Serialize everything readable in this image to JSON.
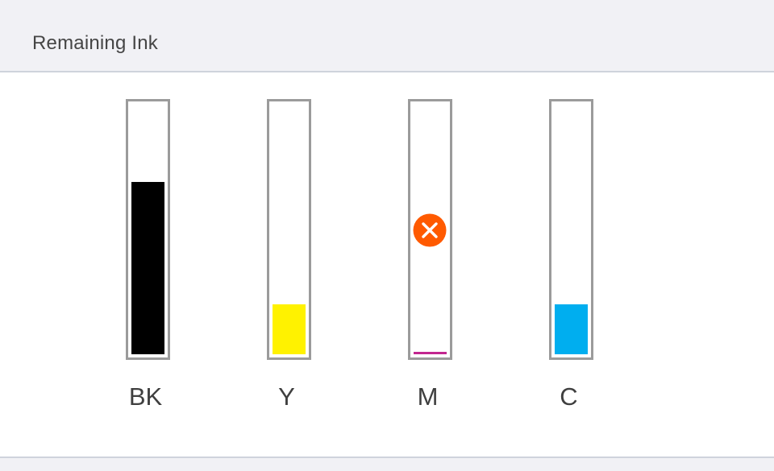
{
  "header": {
    "title": "Remaining Ink"
  },
  "inks": [
    {
      "label": "BK",
      "level_percent": 69,
      "color": "#000000",
      "status": "ok"
    },
    {
      "label": "Y",
      "level_percent": 20,
      "color": "#fff200",
      "status": "ok"
    },
    {
      "label": "M",
      "level_percent": 1,
      "color": "#c2268f",
      "status": "error",
      "status_icon": "error-x-icon",
      "status_color": "#ff5a00"
    },
    {
      "label": "C",
      "level_percent": 20,
      "color": "#00aeef",
      "status": "ok"
    }
  ]
}
